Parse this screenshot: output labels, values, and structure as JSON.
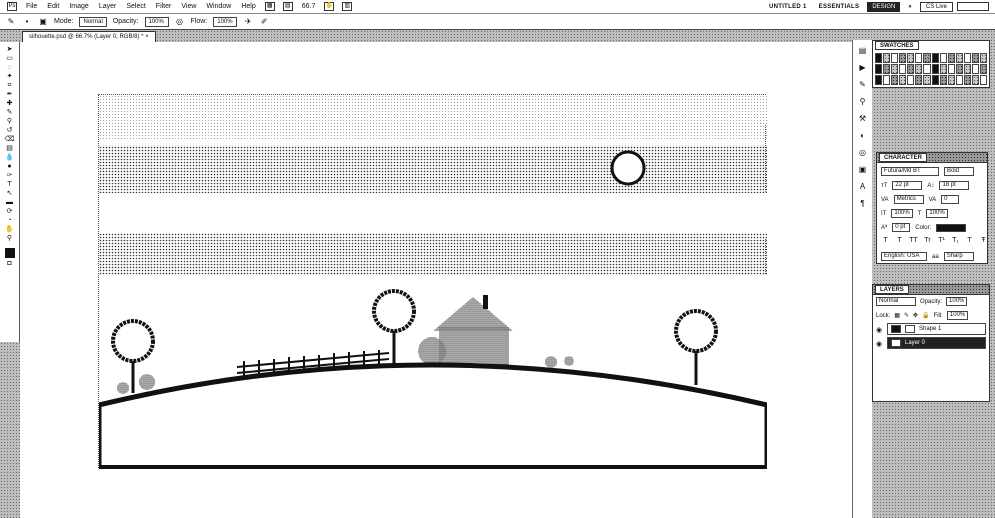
{
  "menubar": {
    "app_icon": "Ps",
    "items": [
      "File",
      "Edit",
      "Image",
      "Layer",
      "Select",
      "Filter",
      "View",
      "Window",
      "Help"
    ],
    "zoom": "66.7",
    "workspace_untitled": "UNTITLED 1",
    "workspace_essentials": "ESSENTIALS",
    "design_button": "DESIGN",
    "more": "»",
    "cs_live": "CS Live"
  },
  "options": {
    "mode_label": "Mode:",
    "mode_value": "Normal",
    "opacity_label": "Opacity:",
    "opacity_value": "100%",
    "flow_label": "Flow:",
    "flow_value": "100%"
  },
  "document": {
    "tab_title": "silhouette.psd @ 66.7% (Layer 0, RGB/8) *",
    "close": "×"
  },
  "swatches": {
    "title": "SWATCHES"
  },
  "character": {
    "title": "CHARACTER",
    "font_family": "Futura/Md BT",
    "font_style": "Bold",
    "font_size": "22 pt",
    "leading": "18 pt",
    "kerning": "Metrics",
    "tracking": "0",
    "vscale": "100%",
    "hscale": "100%",
    "baseline": "0 pt",
    "color_label": "Color:",
    "language": "English: USA",
    "aa": "Sharp",
    "styles": [
      "T",
      "T",
      "TT",
      "Tr",
      "T¹",
      "T₁",
      "T",
      "Ŧ"
    ]
  },
  "layers": {
    "title": "LAYERS",
    "blend": "Normal",
    "opacity_label": "Opacity:",
    "opacity_value": "100%",
    "lock_label": "Lock:",
    "fill_label": "Fill:",
    "fill_value": "100%",
    "items": [
      {
        "name": "Shape 1"
      },
      {
        "name": "Layer 0"
      }
    ]
  },
  "colors": {
    "foreground": "#111111",
    "panel_bg": "#ffffff",
    "selected_layer": "#222222"
  }
}
